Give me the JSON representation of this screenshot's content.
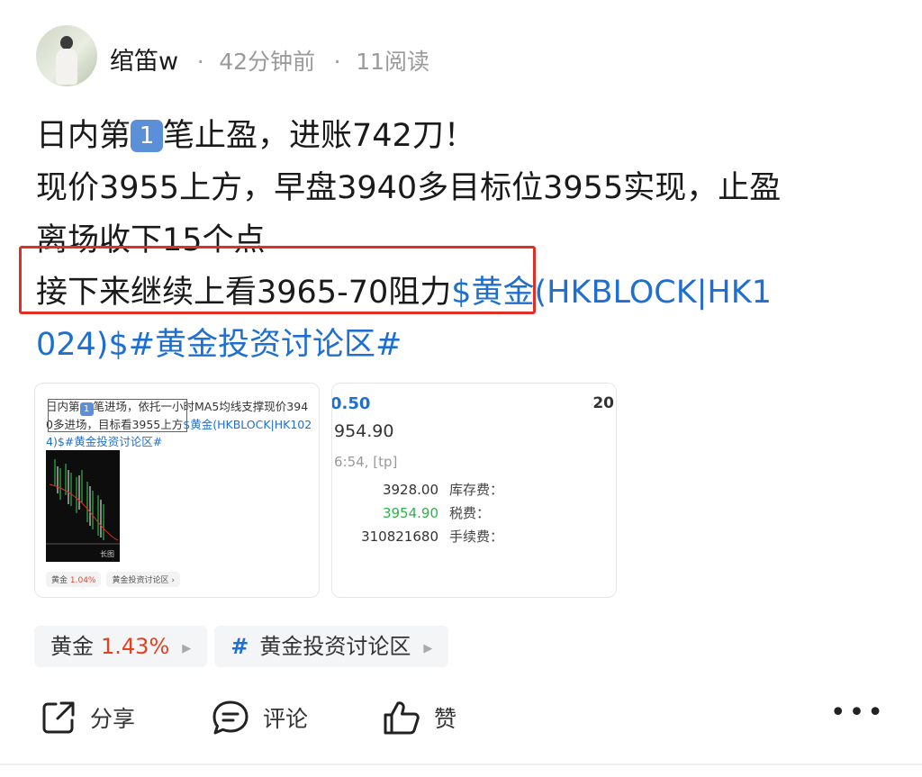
{
  "author": {
    "name": "绾笛w",
    "time_ago": "42分钟前",
    "reads": "11阅读",
    "separator": "·"
  },
  "post": {
    "line1_a": "日内第",
    "line1_badge": "1",
    "line1_b": "笔止盈，进账742刀！",
    "line2": "现价3955上方，早盘3940多目标位3955实现，止盈",
    "line3": "离场收下15个点",
    "line4_text": "接下来继续上看3965-70阻力",
    "line4_link": "$黄金(HKBLOCK|HK1",
    "line5_link": "024)$#黄金投资讨论区#"
  },
  "thumb1": {
    "text_a": "日内第",
    "badge": "1",
    "text_b": "笔进场，依托一小时MA5均线支撑现价394",
    "text_c": "0多进场，目标看3955上方",
    "link_a": "$黄金(HKBLOCK|HK102",
    "link_b": "4)$#黄金投资讨论区#",
    "chart_label": "长图",
    "tag1_name": "黄金",
    "tag1_pct": "1.04%",
    "tag2": "黄金投资讨论区 ›"
  },
  "thumb2": {
    "top_value": "0.50",
    "right_value": "20",
    "price": "954.90",
    "time": "6:54, [tp]",
    "rows": [
      {
        "value": "3928.00",
        "label": "库存费："
      },
      {
        "value": "3954.90",
        "label": "税费："
      },
      {
        "value": "310821680",
        "label": "手续费："
      }
    ]
  },
  "tags": {
    "stock_name": "黄金",
    "stock_pct": "1.43%",
    "topic_hash": "#",
    "topic_name": "黄金投资讨论区",
    "arrow": "▶"
  },
  "actions": {
    "share": "分享",
    "comment": "评论",
    "like": "赞",
    "more": "•••"
  },
  "colors": {
    "link": "#1f6fd1",
    "highlight_box": "#e02f25",
    "up_red": "#e3411f",
    "green": "#2db34a"
  }
}
